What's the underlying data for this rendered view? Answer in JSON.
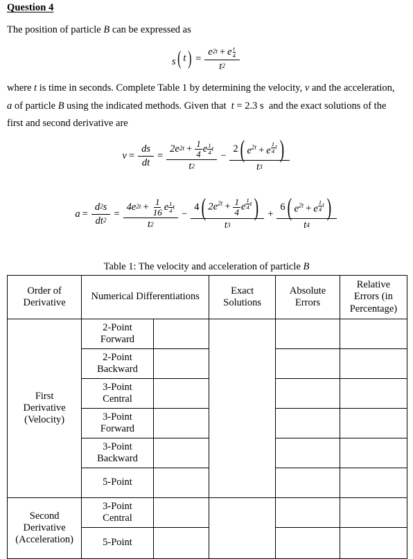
{
  "document": {
    "heading": "Question 4",
    "intro_line": "The position of particle B can be expressed as",
    "intro_prefix": "The position of particle ",
    "intro_var": "B",
    "intro_suffix": " can be expressed as",
    "paragraph_lines": [
      "where t is time in seconds. Complete Table 1 by determining the velocity, v and the acceleration,",
      "a of particle B using the indicated methods. Given that t = 2.3 s and the exact solutions of the",
      "first and second derivative are"
    ],
    "given_time": "t = 2.3 s"
  },
  "equations": {
    "position": {
      "lhs": "s(t)",
      "relation": "=",
      "numerator": "e^{2t} + e^{t/4}",
      "denominator": "t^2",
      "plain": "s(t) = (e^{2t} + e^{t/4}) / t^2"
    },
    "velocity": {
      "lhs": "v",
      "derivative": "ds/dt",
      "plain": "v = ds/dt = (2e^{2t} + (1/4)e^{(1/4)t}) / t^2 - 2(e^{2t} + e^{(1/4)t}) / t^3",
      "term1_num": "2e^{2t} + (1/4) e^{(1/4)t}",
      "term1_den": "t^2",
      "term2_coeff": "2",
      "term2_num": "e^{2t} + e^{(1/4)t}",
      "term2_den": "t^3"
    },
    "acceleration": {
      "lhs": "a",
      "derivative": "d^2 s / dt^2",
      "plain": "a = d^2s/dt^2 = (4e^{2t} + (1/16)e^{(1/4)t}) / t^2 - 4(2e^{2t} + (1/4)e^{(1/4)t}) / t^3 + 6(e^{2t} + e^{(1/4)t}) / t^4",
      "term1_num": "4e^{2t} + (1/16) e^{(1/4)t}",
      "term1_den": "t^2",
      "term2_coeff": "4",
      "term2_num": "2e^{2t} + (1/4) e^{(1/4)t}",
      "term2_den": "t^3",
      "term3_coeff": "6",
      "term3_num": "e^{2t} + e^{(1/4)t}",
      "term3_den": "t^4"
    }
  },
  "table": {
    "caption_prefix": "Table 1: The velocity and acceleration of particle ",
    "caption_var": "B",
    "headers": {
      "order": "Order of Derivative",
      "order_line1": "Order of",
      "order_line2": "Derivative",
      "numerical": "Numerical Differentiations",
      "exact_line1": "Exact",
      "exact_line2": "Solutions",
      "absolute_line1": "Absolute",
      "absolute_line2": "Errors",
      "relative_line1": "Relative",
      "relative_line2": "Errors (in",
      "relative_line3": "Percentage)"
    },
    "groups": [
      {
        "label_line1": "First",
        "label_line2": "Derivative",
        "label_line3": "(Velocity)",
        "rows": [
          {
            "method_line1": "2-Point",
            "method_line2": "Forward",
            "value": "",
            "absolute_error": "",
            "relative_error": ""
          },
          {
            "method_line1": "2-Point",
            "method_line2": "Backward",
            "value": "",
            "absolute_error": "",
            "relative_error": ""
          },
          {
            "method_line1": "3-Point",
            "method_line2": "Central",
            "value": "",
            "absolute_error": "",
            "relative_error": ""
          },
          {
            "method_line1": "3-Point",
            "method_line2": "Forward",
            "value": "",
            "absolute_error": "",
            "relative_error": ""
          },
          {
            "method_line1": "3-Point",
            "method_line2": "Backward",
            "value": "",
            "absolute_error": "",
            "relative_error": ""
          },
          {
            "method_line1": "5-Point",
            "method_line2": "",
            "value": "",
            "absolute_error": "",
            "relative_error": ""
          }
        ],
        "exact_solution": ""
      },
      {
        "label_line1": "Second",
        "label_line2": "Derivative",
        "label_line3": "(Acceleration)",
        "rows": [
          {
            "method_line1": "3-Point",
            "method_line2": "Central",
            "value": "",
            "absolute_error": "",
            "relative_error": ""
          },
          {
            "method_line1": "5-Point",
            "method_line2": "",
            "value": "",
            "absolute_error": "",
            "relative_error": ""
          }
        ],
        "exact_solution": ""
      }
    ]
  },
  "colors": {
    "page_background": "#ffffff",
    "text": "#000000",
    "table_border": "#000000"
  }
}
